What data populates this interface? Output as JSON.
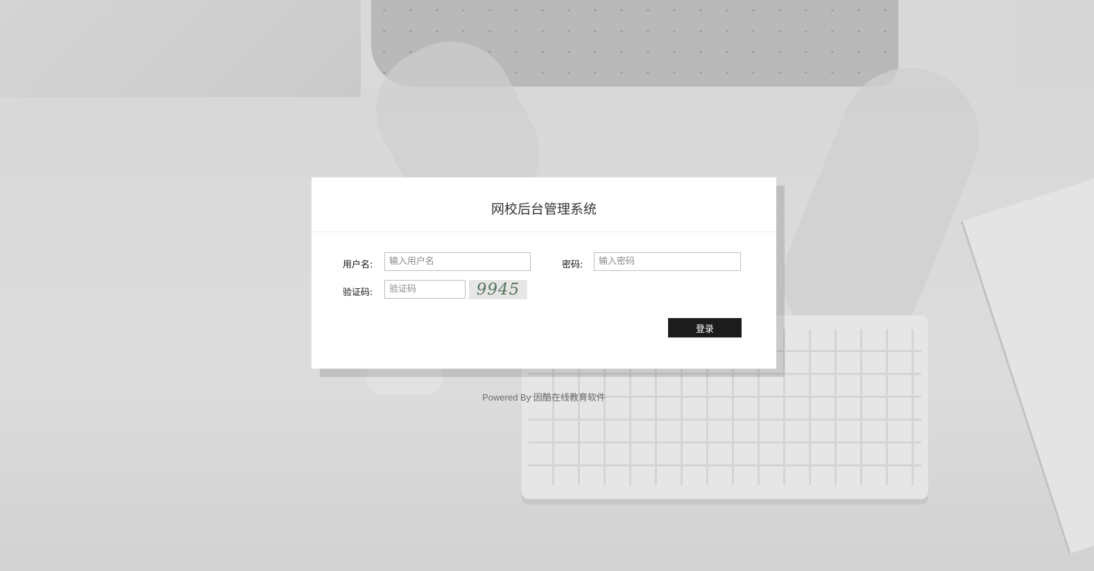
{
  "login": {
    "title": "网校后台管理系统",
    "username_label": "用户名:",
    "username_placeholder": "输入用户名",
    "password_label": "密码:",
    "password_placeholder": "输入密码",
    "captcha_label": "验证码:",
    "captcha_placeholder": "验证码",
    "captcha_code": "9945",
    "submit_label": "登录"
  },
  "footer": {
    "text": "Powered By 因酷在线教育软件"
  },
  "colors": {
    "card_background": "#ffffff",
    "button_background": "#1c1c1c",
    "captcha_text": "#55735a"
  }
}
